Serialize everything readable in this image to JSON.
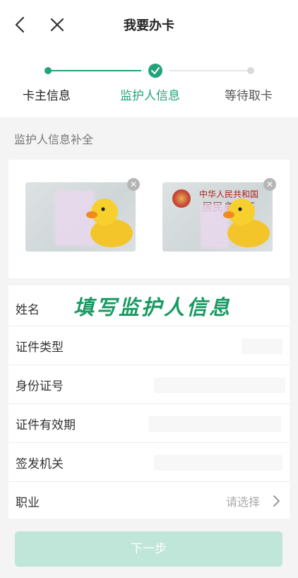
{
  "nav": {
    "title": "我要办卡",
    "back_icon": "chevron-left-icon",
    "close_icon": "close-icon"
  },
  "steps": {
    "items": [
      {
        "label": "卡主信息",
        "state": "done"
      },
      {
        "label": "监护人信息",
        "state": "current"
      },
      {
        "label": "等待取卡",
        "state": "todo"
      }
    ],
    "accent_color": "#22a37a"
  },
  "section": {
    "title": "监护人信息补全"
  },
  "id_cards": {
    "back_text_line1": "中华人民共和国",
    "back_text_line2": "居民身份证",
    "remove_icon": "close-icon"
  },
  "form": {
    "annotation": "填写监护人信息",
    "fields": [
      {
        "label": "姓名"
      },
      {
        "label": "证件类型"
      },
      {
        "label": "身份证号"
      },
      {
        "label": "证件有效期"
      },
      {
        "label": "签发机关"
      },
      {
        "label": "职业",
        "placeholder": "请选择"
      }
    ]
  },
  "footer": {
    "next_label": "下一步",
    "button_color": "#bfe6d8"
  }
}
